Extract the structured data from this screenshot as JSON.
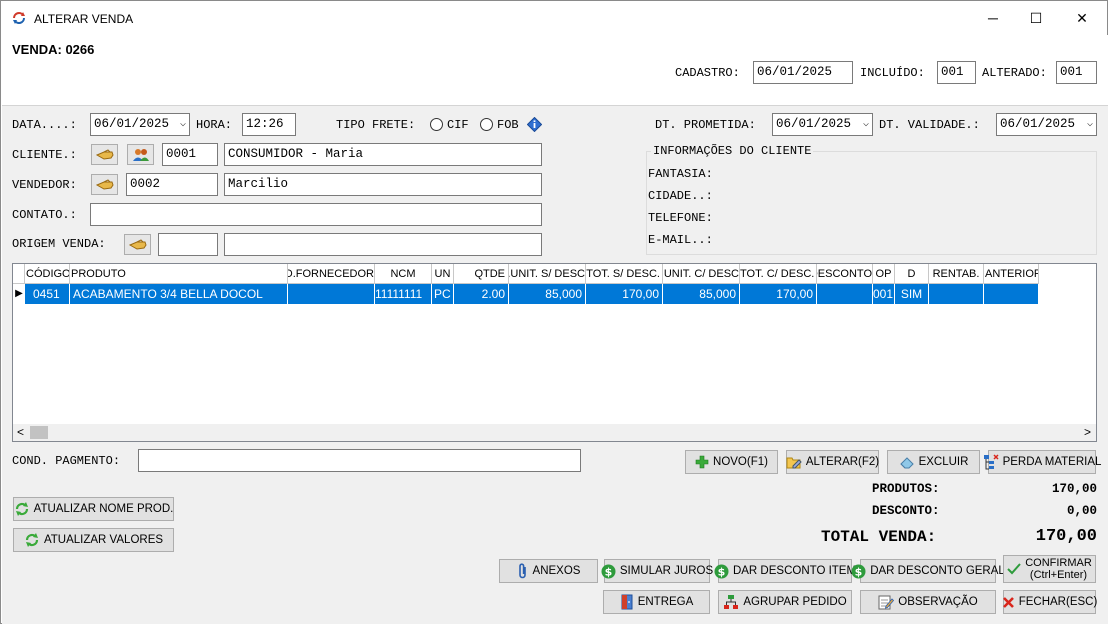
{
  "window": {
    "title": "ALTERAR VENDA",
    "controls": [
      "─",
      "☐",
      "✕"
    ]
  },
  "header": {
    "venda_label": "VENDA: 0266",
    "cadastro_label": "CADASTRO:",
    "cadastro_value": "06/01/2025",
    "incluido_label": "INCLUÍDO:",
    "incluido_value": "001",
    "alterado_label": "ALTERADO:",
    "alterado_value": "001"
  },
  "form": {
    "data_label": "DATA....:",
    "data_value": "06/01/2025",
    "hora_label": "HORA:",
    "hora_value": "12:26",
    "tipo_frete_label": "TIPO FRETE:",
    "frete_cif": "CIF",
    "frete_fob": "FOB",
    "dt_prometida_label": "DT. PROMETIDA:",
    "dt_prometida_value": "06/01/2025",
    "dt_validade_label": "DT. VALIDADE.:",
    "dt_validade_value": "06/01/2025",
    "cliente_label": "CLIENTE.:",
    "cliente_code": "0001",
    "cliente_name": "CONSUMIDOR - Maria",
    "vendedor_label": "VENDEDOR:",
    "vendedor_code": "0002",
    "vendedor_name": "Marcilio",
    "contato_label": "CONTATO.:",
    "contato_value": "",
    "origem_label": "ORIGEM VENDA:",
    "origem_code": "",
    "origem_name": ""
  },
  "info_cliente": {
    "title": "INFORMAÇÕES DO CLIENTE",
    "fantasia_label": "FANTASIA:",
    "cidade_label": "CIDADE..:",
    "telefone_label": "TELEFONE:",
    "email_label": "E-MAIL..:"
  },
  "grid": {
    "columns": [
      "CÓDIGO",
      "PRODUTO",
      "CÓD.FORNECEDOR",
      "NCM",
      "UN",
      "QTDE",
      "UNIT. S/ DESC.",
      "TOT. S/ DESC.",
      "UNIT. C/ DESC.",
      "TOT. C/ DESC.",
      "DESCONTO",
      "OP",
      "D",
      "RENTAB.",
      "ANTERIOR"
    ],
    "rows": [
      [
        "0451",
        "ACABAMENTO 3/4 BELLA DOCOL",
        "",
        "11111111",
        "PC",
        "2.00",
        "85,000",
        "170,00",
        "85,000",
        "170,00",
        "",
        "001",
        "SIM",
        "",
        ""
      ]
    ],
    "row_indicator": "▶",
    "scroll_left": "<",
    "scroll_right": ">"
  },
  "payment": {
    "cond_label": "COND. PAGMENTO:",
    "cond_value": ""
  },
  "actions": {
    "novo": "NOVO(F1)",
    "alterar": "ALTERAR(F2)",
    "excluir": "EXCLUIR",
    "perda": "PERDA MATERIAL",
    "atualizar_nome": "ATUALIZAR NOME PROD.",
    "atualizar_valores": "ATUALIZAR VALORES",
    "anexos": "ANEXOS",
    "simular_juros": "SIMULAR JUROS",
    "desconto_item": "DAR DESCONTO ITEM",
    "desconto_geral": "DAR DESCONTO GERAL",
    "confirmar_1": "CONFIRMAR",
    "confirmar_2": "(Ctrl+Enter)",
    "entrega": "ENTREGA",
    "agrupar": "AGRUPAR PEDIDO",
    "observacao": "OBSERVAÇÃO",
    "fechar": "FECHAR(ESC)"
  },
  "totals": {
    "produtos_label": "PRODUTOS:",
    "produtos_value": "170,00",
    "desconto_label": "DESCONTO:",
    "desconto_value": "0,00",
    "total_label": "TOTAL VENDA:",
    "total_value": "170,00"
  },
  "icons": {
    "app": "refresh-arrows-icon",
    "search": "hand-pointer-icon",
    "people": "people-icon",
    "info": "info-diamond-icon",
    "colors": {
      "selection": "#0078d7",
      "money_green": "#2e9b3c",
      "close_red": "#d9261c"
    }
  }
}
